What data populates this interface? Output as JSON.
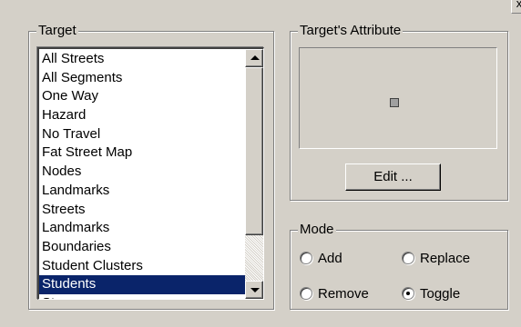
{
  "close_label": "x",
  "target": {
    "title": "Target",
    "items": [
      "All Streets",
      "All Segments",
      "One Way",
      "Hazard",
      "No Travel",
      "Fat Street Map",
      "Nodes",
      "Landmarks",
      "Streets",
      "Landmarks",
      "Boundaries",
      "Student Clusters",
      "Students",
      "Stops"
    ],
    "selected_index": 12
  },
  "attribute": {
    "title": "Target's Attribute",
    "edit_label": "Edit ..."
  },
  "mode": {
    "title": "Mode",
    "options": {
      "add": "Add",
      "replace": "Replace",
      "remove": "Remove",
      "toggle": "Toggle"
    },
    "selected": "toggle"
  },
  "colors": {
    "dialog_bg": "#d4d0c8",
    "selection": "#0a246a",
    "swatch": "#a0a0a0"
  }
}
